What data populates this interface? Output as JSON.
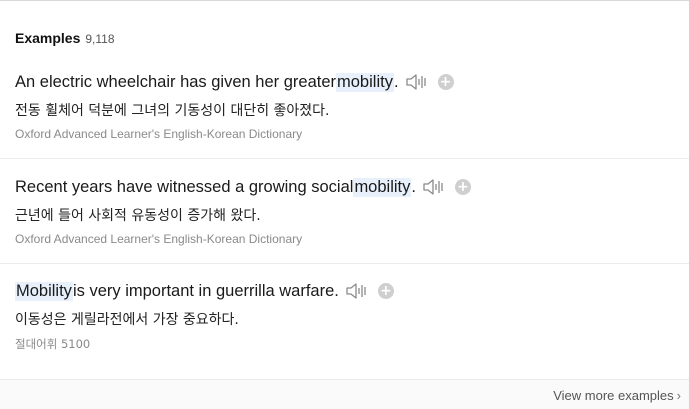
{
  "header": {
    "title": "Examples",
    "count": "9,118"
  },
  "examples": [
    {
      "en_before": "An electric wheelchair has given her greater ",
      "en_highlight": "mobility",
      "en_after": ".",
      "ko": "전동 휠체어 덕분에 그녀의 기동성이 대단히 좋아졌다.",
      "source": "Oxford Advanced Learner's English-Korean Dictionary"
    },
    {
      "en_before": "Recent years have witnessed a growing social ",
      "en_highlight": "mobility",
      "en_after": ".",
      "ko": "근년에 들어 사회적 유동성이 증가해 왔다.",
      "source": "Oxford Advanced Learner's English-Korean Dictionary"
    },
    {
      "en_before": "",
      "en_highlight": "Mobility",
      "en_after": " is very important in guerrilla warfare.",
      "ko": "이동성은 게릴라전에서 가장 중요하다.",
      "source": "절대어휘 5100"
    }
  ],
  "icons": {
    "speaker": "speaker-icon",
    "add": "add-circle-icon",
    "chevron": "chevron-right-icon"
  },
  "plus_glyph": "+",
  "footer": {
    "more_label": "View more examples",
    "chevron": "›"
  },
  "colors": {
    "highlight": "#e7f0fb",
    "source_text": "#8a8a8a",
    "add_button": "#cfcfcf"
  }
}
